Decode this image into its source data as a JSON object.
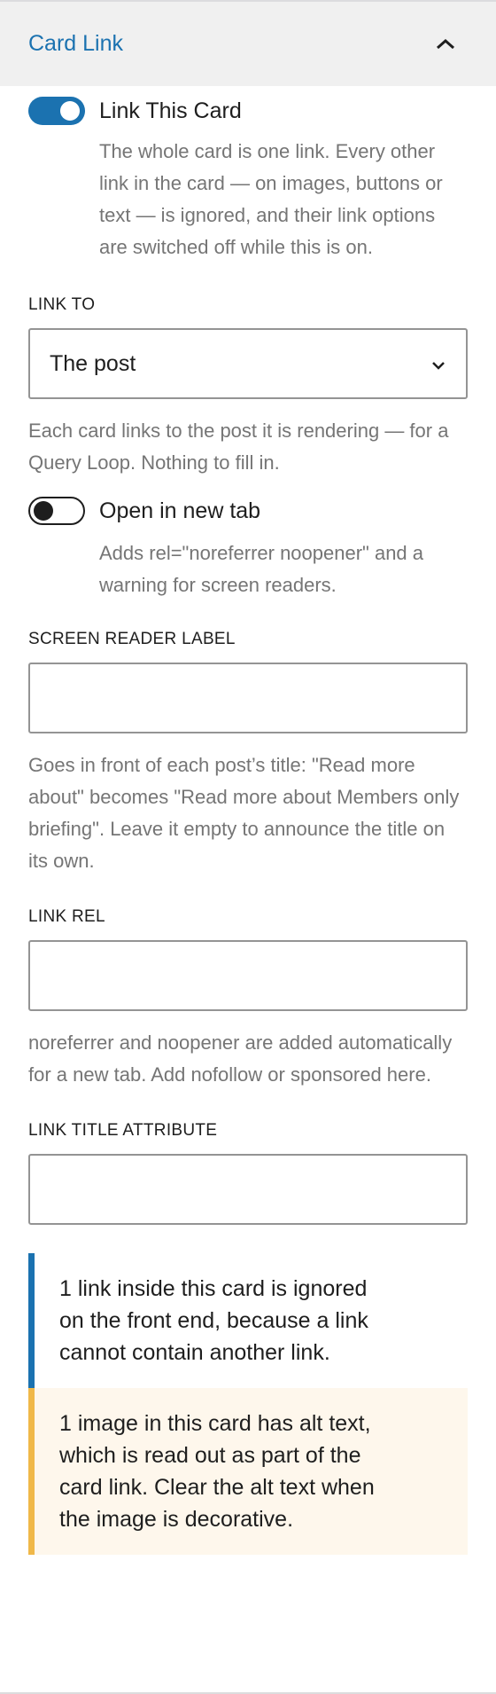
{
  "panel": {
    "title": "Card Link",
    "toggle_icon": "chevron-up-icon"
  },
  "link_card": {
    "label": "Link This Card",
    "enabled": true,
    "help": "The whole card is one link. Every other link in the card — on images, buttons or text — is ignored, and their link options are switched off while this is on."
  },
  "link_to": {
    "label": "Link to",
    "value": "The post",
    "help": "Each card links to the post it is rendering — for a Query Loop. Nothing to fill in."
  },
  "new_tab": {
    "label": "Open in new tab",
    "enabled": false,
    "help": "Adds rel=\"noreferrer noopener\" and a warning for screen readers."
  },
  "screen_reader_label": {
    "label": "Screen reader label",
    "value": "",
    "help": "Goes in front of each post’s title: \"Read more about\" becomes \"Read more about Members only briefing\". Leave it empty to announce the title on its own."
  },
  "link_rel": {
    "label": "Link rel",
    "value": "",
    "help": "noreferrer and noopener are added automatically for a new tab. Add nofollow or sponsored here."
  },
  "link_title": {
    "label": "Link title attribute",
    "value": ""
  },
  "notices": {
    "info": "1 link inside this card is ignored on the front end, because a link cannot contain another link.",
    "warning": "1 image in this card has alt text, which is read out as part of the card link. Clear the alt text when the image is decorative."
  },
  "colors": {
    "accent": "#1b72b0",
    "warning": "#f0b849",
    "help_text": "#757575"
  }
}
